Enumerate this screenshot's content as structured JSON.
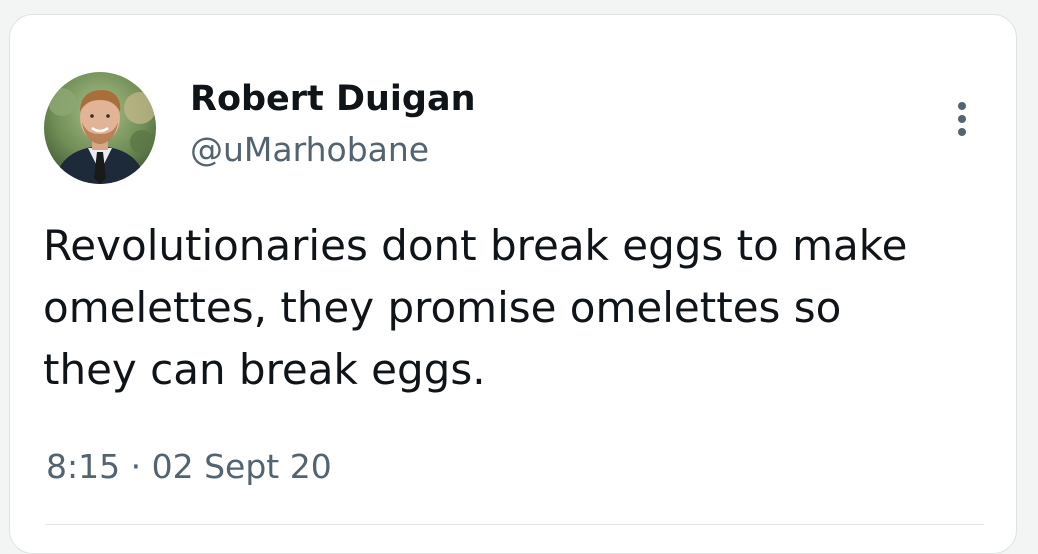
{
  "tweet": {
    "author": {
      "display_name": "Robert Duigan",
      "handle": "@uMarhobane",
      "avatar_icon": "profile-photo"
    },
    "text_lines": [
      "Revolutionaries dont break eggs to make",
      "omelettes, they promise omelettes so",
      "they can break eggs."
    ],
    "time": "8:15",
    "separator": "·",
    "date": "02 Sept 20",
    "more_icon": "more-vertical-icon"
  },
  "colors": {
    "primary_text": "#0f1419",
    "secondary_text": "#536471",
    "card_border": "#dfe2e5",
    "background": "#f3f4f4"
  }
}
